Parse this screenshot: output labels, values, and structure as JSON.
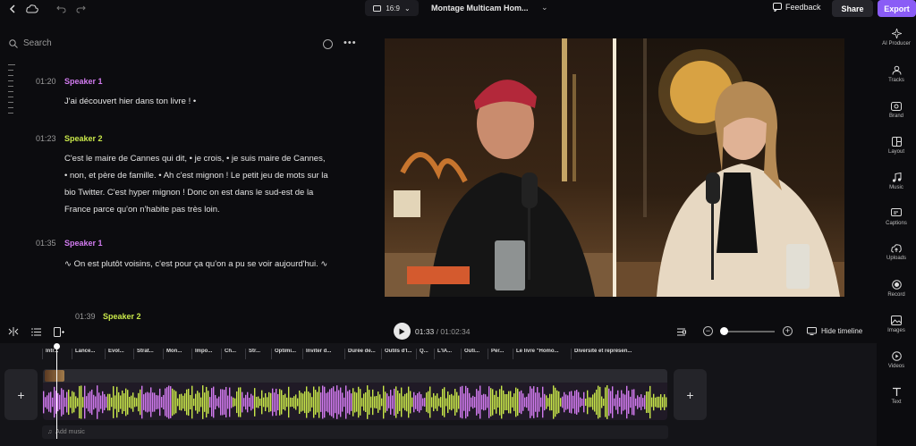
{
  "topbar": {
    "aspect_ratio": "16:9",
    "project_title": "Montage Multicam Hom...",
    "feedback_label": "Feedback",
    "share_label": "Share",
    "export_label": "Export"
  },
  "transcript": {
    "search_placeholder": "Search",
    "segments": [
      {
        "time": "01:20",
        "speaker": "Speaker 1",
        "text": "J'ai découvert hier dans ton livre ! •"
      },
      {
        "time": "01:23",
        "speaker": "Speaker 2",
        "text": "C'est le maire de Cannes qui dit, • je crois, • je suis maire de Cannes, • non, et père de famille. • Ah c'est mignon ! Le petit jeu de mots sur la bio Twitter. C'est hyper mignon ! Donc on est dans le sud-est de la France parce qu'on n'habite pas très loin."
      },
      {
        "time": "01:35",
        "speaker": "Speaker 1",
        "text": "∿ On est plutôt voisins, c'est pour ça qu'on a pu se voir aujourd'hui. ∿"
      },
      {
        "time": "01:39",
        "speaker": "Speaker 2",
        "text": ""
      }
    ]
  },
  "sidebar": {
    "items": [
      {
        "label": "AI Producer",
        "icon": "sparkle-icon"
      },
      {
        "label": "Tracks",
        "icon": "users-icon"
      },
      {
        "label": "Brand",
        "icon": "brand-icon"
      },
      {
        "label": "Layout",
        "icon": "layout-icon"
      },
      {
        "label": "Music",
        "icon": "music-icon"
      },
      {
        "label": "Captions",
        "icon": "captions-icon"
      },
      {
        "label": "Uploads",
        "icon": "upload-icon"
      },
      {
        "label": "Record",
        "icon": "record-icon"
      },
      {
        "label": "Images",
        "icon": "image-icon"
      },
      {
        "label": "Videos",
        "icon": "video-icon"
      },
      {
        "label": "Text",
        "icon": "text-icon"
      }
    ]
  },
  "playback": {
    "current_time": "01:33",
    "separator": "/",
    "total_time": "01:02:34",
    "hide_timeline_label": "Hide timeline",
    "zoom_level": 0.05
  },
  "timeline": {
    "chapters": [
      "Intr...",
      "Lance...",
      "Évol...",
      "Strat...",
      "Mon...",
      "Impo...",
      "Ch...",
      "Str...",
      "Optimi...",
      "Inviter d...",
      "Durée de...",
      "Outils d'I...",
      "Q...",
      "L'IA...",
      "Outi...",
      "Per...",
      "Le livre \"Homo...",
      "Diversité et représen..."
    ],
    "add_music_label": "Add music",
    "add_label": "+",
    "colors": {
      "speaker1": "#d27bf0",
      "speaker2": "#c9e84a",
      "accent": "#8a5cf6"
    }
  }
}
